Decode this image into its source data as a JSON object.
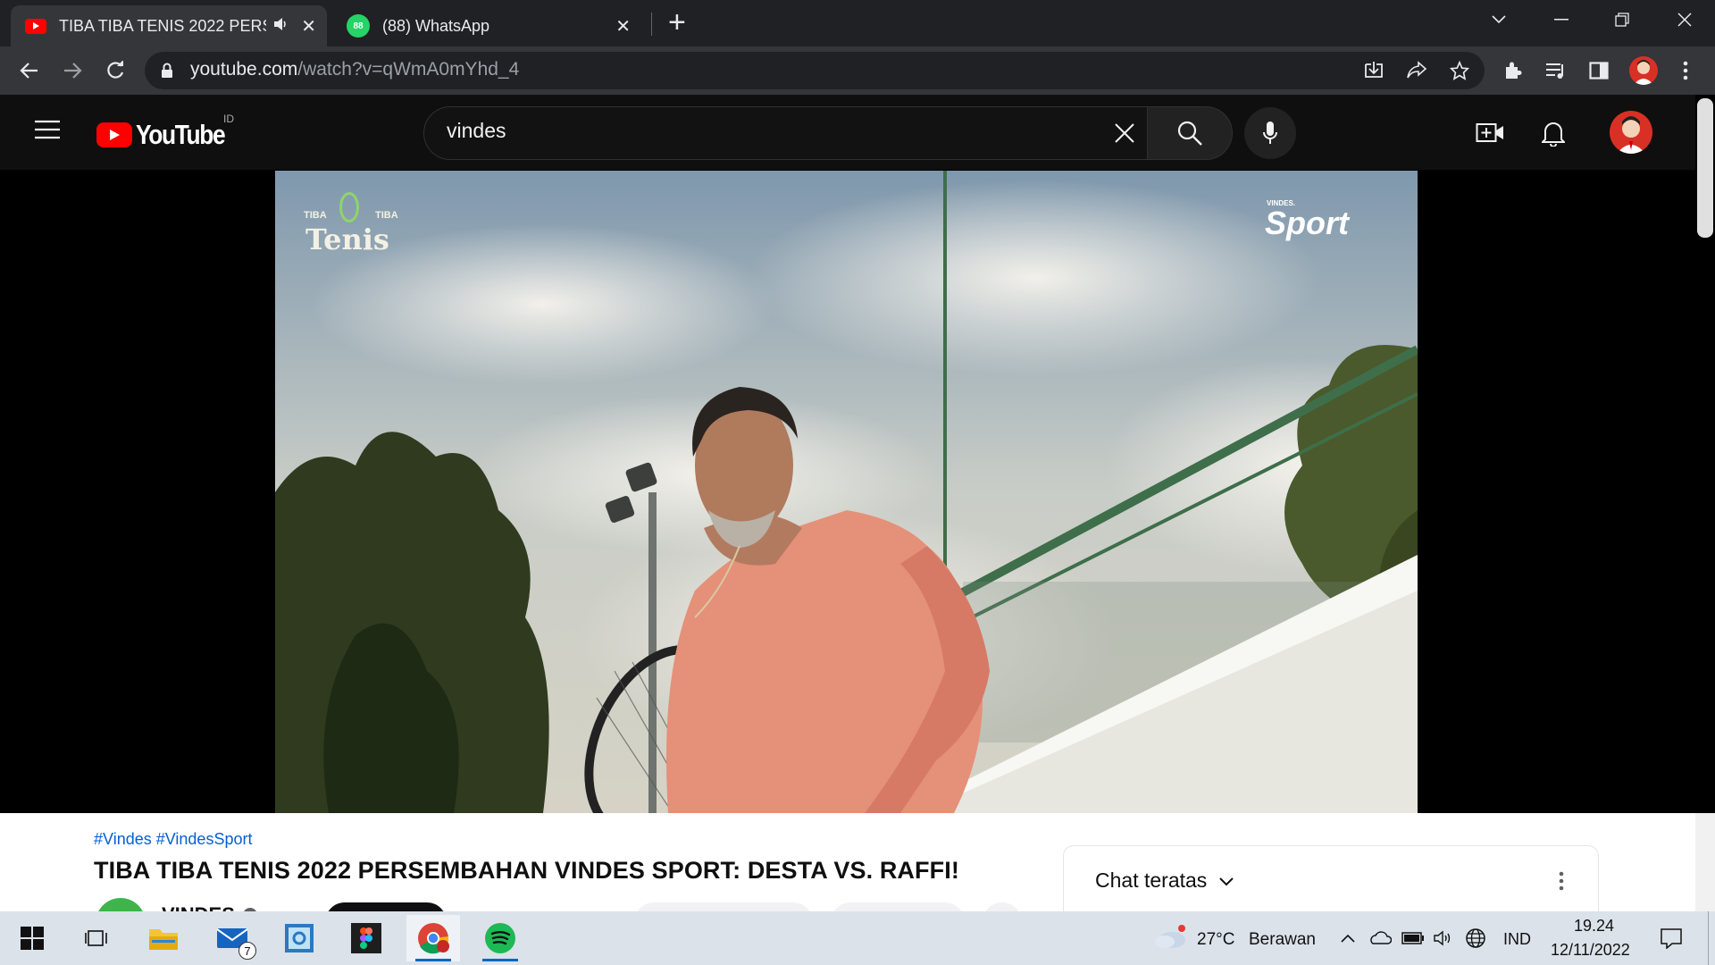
{
  "browser": {
    "tabs": [
      {
        "title": "TIBA TIBA TENIS 2022 PERSEMBAHAN VINDES SPORT: DESTA VS. RAFFI!",
        "icon": "youtube-icon",
        "audio": true,
        "active": true
      },
      {
        "title": "(88) WhatsApp",
        "icon": "whatsapp-icon",
        "badge": "88",
        "active": false
      }
    ],
    "new_tab_label": "+",
    "url_host": "youtube.com",
    "url_path": "/watch?v=qWmA0mYhd_4"
  },
  "youtube": {
    "logo_text": "YouTube",
    "country_code": "ID",
    "search_value": "vindes",
    "video": {
      "overlay_left_small_1": "TIBA",
      "overlay_left_small_2": "TIBA",
      "overlay_left_big": "Tenis",
      "overlay_right_small": "VINDES.",
      "overlay_right_big": "Sport"
    },
    "hashtags": "#Vindes #VindesSport",
    "title": "TIBA TIBA TENIS 2022 PERSEMBAHAN VINDES SPORT: DESTA VS. RAFFI!",
    "channel_name_partial": "VINDES",
    "chat": {
      "title": "Chat teratas"
    }
  },
  "taskbar": {
    "apps": [
      "windows-start",
      "task-view",
      "file-explorer",
      "mail",
      "outlook",
      "figma",
      "chrome",
      "spotify"
    ],
    "mail_badge": "7",
    "weather_temp": "27°C",
    "weather_desc": "Berawan",
    "language": "IND",
    "time": "19.24",
    "date": "12/11/2022"
  },
  "colors": {
    "chrome_dark": "#202124",
    "chrome_toolbar": "#35363a",
    "youtube_red": "#ff0000",
    "link_blue": "#065fd4",
    "spotify_green": "#1db954",
    "whatsapp_green": "#25d366"
  }
}
